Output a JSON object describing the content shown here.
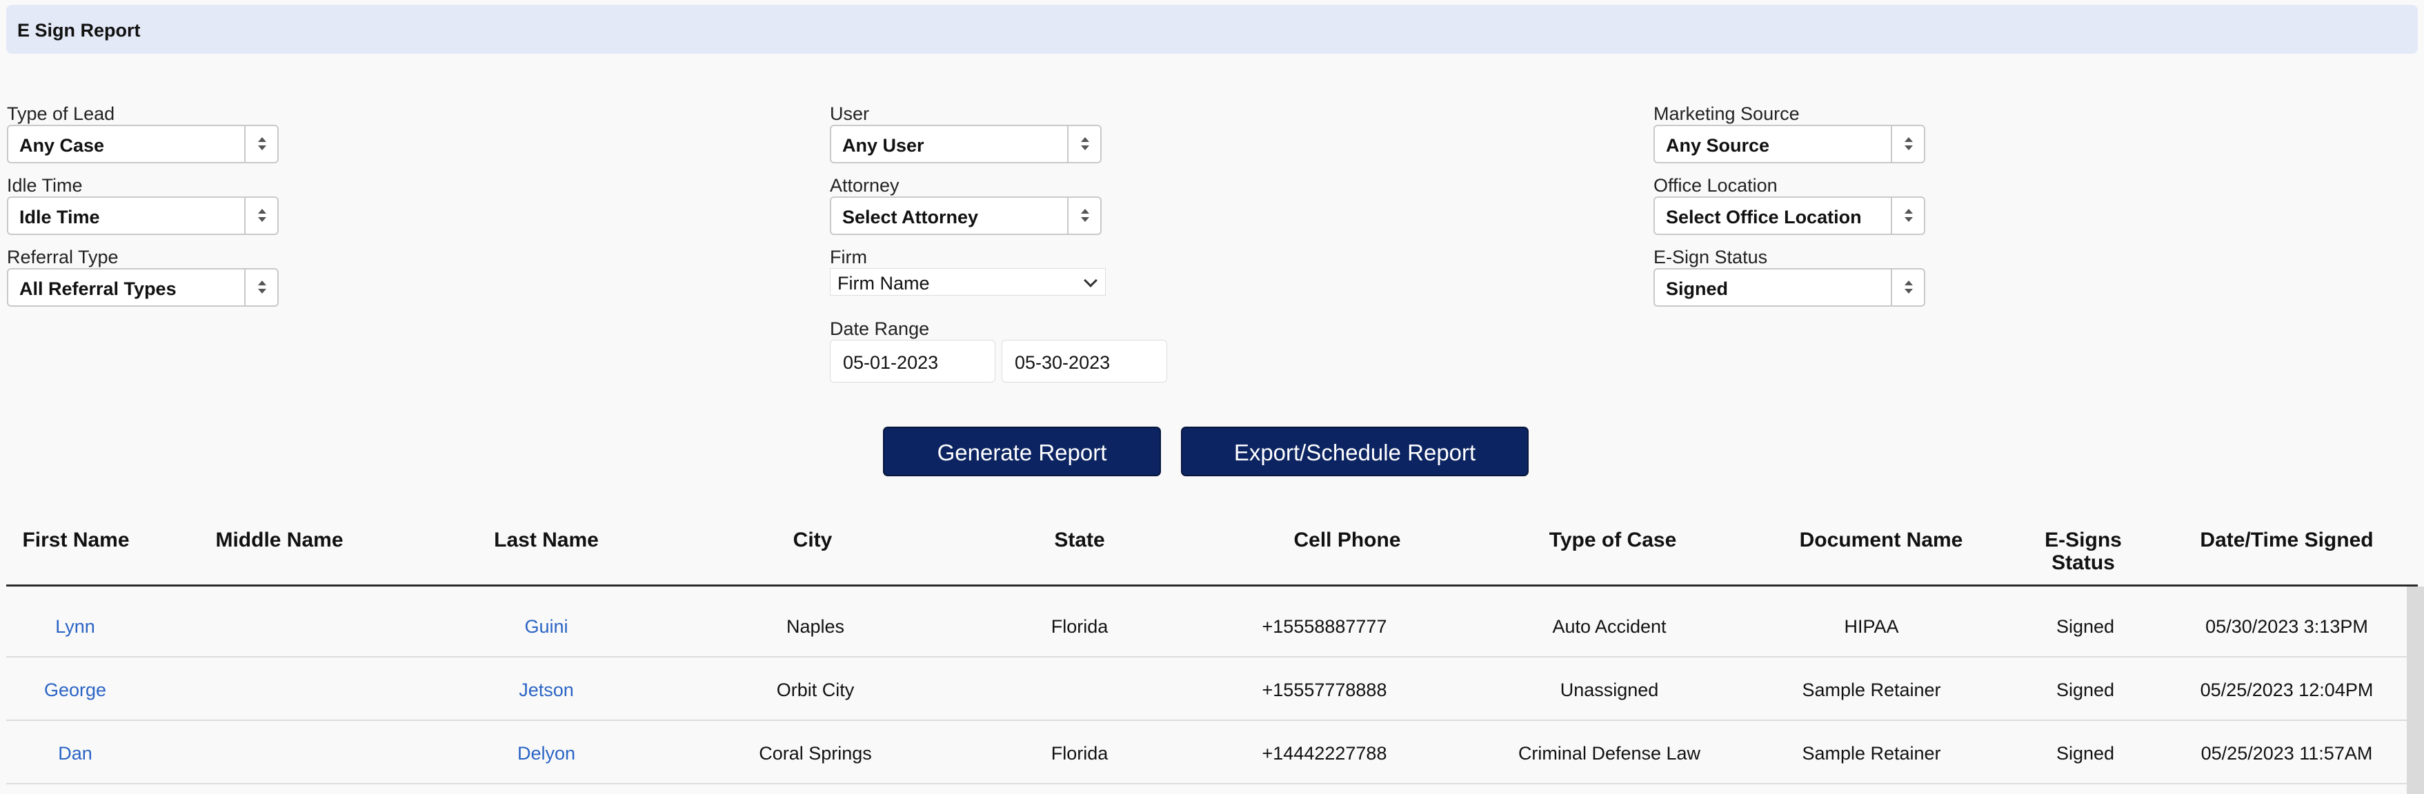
{
  "title": "E Sign Report",
  "filters": {
    "type_of_lead": {
      "label": "Type of Lead",
      "value": "Any Case"
    },
    "idle_time": {
      "label": "Idle Time",
      "value": "Idle Time"
    },
    "referral_type": {
      "label": "Referral Type",
      "value": "All Referral Types"
    },
    "user": {
      "label": "User",
      "value": "Any User"
    },
    "attorney": {
      "label": "Attorney",
      "value": "Select Attorney"
    },
    "firm": {
      "label": "Firm",
      "value": "Firm Name"
    },
    "date_range": {
      "label": "Date Range",
      "start": "05-01-2023",
      "end": "05-30-2023"
    },
    "marketing_source": {
      "label": "Marketing Source",
      "value": "Any Source"
    },
    "office_location": {
      "label": "Office Location",
      "value": "Select Office Location"
    },
    "esign_status": {
      "label": "E-Sign Status",
      "value": "Signed"
    }
  },
  "buttons": {
    "generate": "Generate Report",
    "export": "Export/Schedule Report"
  },
  "table": {
    "headers": {
      "first_name": "First Name",
      "middle_name": "Middle Name",
      "last_name": "Last Name",
      "city": "City",
      "state": "State",
      "cell_phone": "Cell Phone",
      "type_of_case": "Type of Case",
      "document_name": "Document Name",
      "esigns_status_1": "E-Signs",
      "esigns_status_2": "Status",
      "date_signed": "Date/Time Signed"
    },
    "rows": [
      {
        "first": "Lynn",
        "middle": "",
        "last": "Guini",
        "city": "Naples",
        "state": "Florida",
        "phone": "+15558887777",
        "case": "Auto Accident",
        "doc": "HIPAA",
        "status": "Signed",
        "date": "05/30/2023 3:13PM"
      },
      {
        "first": "George",
        "middle": "",
        "last": "Jetson",
        "city": "Orbit City",
        "state": "",
        "phone": "+15557778888",
        "case": "Unassigned",
        "doc": "Sample Retainer",
        "status": "Signed",
        "date": "05/25/2023 12:04PM"
      },
      {
        "first": "Dan",
        "middle": "",
        "last": "Delyon",
        "city": "Coral Springs",
        "state": "Florida",
        "phone": "+14442227788",
        "case": "Criminal Defense Law",
        "doc": "Sample Retainer",
        "status": "Signed",
        "date": "05/25/2023 11:57AM"
      }
    ]
  }
}
